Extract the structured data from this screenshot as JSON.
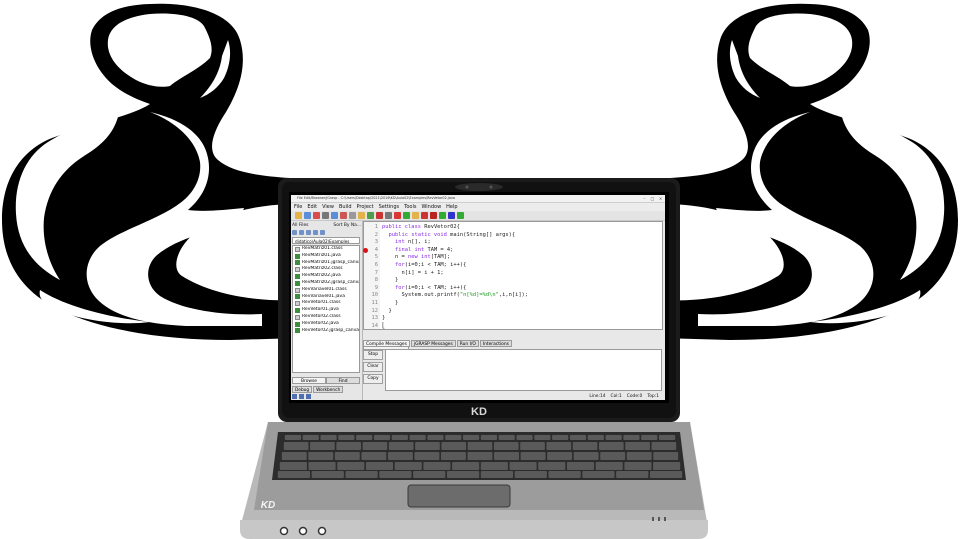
{
  "window": {
    "title": "File Edit/Browser/jGrasp - C:\\Users\\Desktop\\2021\\2016\\KD\\Aula02\\Examples\\RevVetor02.java",
    "min_glyph": "–",
    "max_glyph": "□",
    "close_glyph": "×"
  },
  "menu": [
    "File",
    "Edit",
    "View",
    "Build",
    "Project",
    "Settings",
    "Tools",
    "Window",
    "Help"
  ],
  "left_pane": {
    "filter_label": "All Files",
    "sort_label": "Sort By Na...",
    "path": "didatico\\Aula02\\Examples",
    "files": [
      {
        "name": "RevMatriz01.class",
        "kind": "class"
      },
      {
        "name": "RevMatriz01.java",
        "kind": "java"
      },
      {
        "name": "RevMatriz01.jgrasp_canvas",
        "kind": "java"
      },
      {
        "name": "RevMatriz02.class",
        "kind": "class"
      },
      {
        "name": "RevMatriz02.java",
        "kind": "java"
      },
      {
        "name": "RevMatriz02.jgrasp_canvas",
        "kind": "java"
      },
      {
        "name": "RevVariavel01.class",
        "kind": "class"
      },
      {
        "name": "RevVariavel01.java",
        "kind": "java"
      },
      {
        "name": "RevVetor01.class",
        "kind": "class"
      },
      {
        "name": "RevVetor01.java",
        "kind": "java"
      },
      {
        "name": "RevVetor02.class",
        "kind": "class"
      },
      {
        "name": "RevVetor02.java",
        "kind": "java"
      },
      {
        "name": "RevVetor02.jgrasp_canvas",
        "kind": "java"
      }
    ],
    "tabs": [
      "Browse",
      "Find"
    ],
    "tabs2": [
      "Debug",
      "Workbench"
    ]
  },
  "editor": {
    "file_tab": "RevVetor02.java",
    "breakpoint_line": 4,
    "lines": [
      {
        "n": "1",
        "parts": [
          [
            "kw",
            "public class "
          ],
          [
            "pl",
            "RevVetor02{"
          ]
        ]
      },
      {
        "n": "2",
        "parts": [
          [
            "pl",
            "  "
          ],
          [
            "kw",
            "public static void "
          ],
          [
            "pl",
            "main(String[] args){"
          ]
        ]
      },
      {
        "n": "3",
        "parts": [
          [
            "pl",
            "    "
          ],
          [
            "kw",
            "int "
          ],
          [
            "pl",
            "n[], i;"
          ]
        ]
      },
      {
        "n": "4",
        "parts": [
          [
            "pl",
            "    "
          ],
          [
            "kw",
            "final int "
          ],
          [
            "pl",
            "TAM = 4;"
          ]
        ]
      },
      {
        "n": "5",
        "parts": [
          [
            "pl",
            "    n = "
          ],
          [
            "kw",
            "new int"
          ],
          [
            "pl",
            "[TAM];"
          ]
        ]
      },
      {
        "n": "6",
        "parts": [
          [
            "pl",
            "    "
          ],
          [
            "kw",
            "for"
          ],
          [
            "pl",
            "(i=0;i < TAM; i++){"
          ]
        ]
      },
      {
        "n": "7",
        "parts": [
          [
            "pl",
            "      n[i] = i + 1;"
          ]
        ]
      },
      {
        "n": "8",
        "parts": [
          [
            "pl",
            "    }"
          ]
        ]
      },
      {
        "n": "9",
        "parts": [
          [
            "pl",
            "    "
          ],
          [
            "kw",
            "for"
          ],
          [
            "pl",
            "(i=0;i < TAM; i++){"
          ]
        ]
      },
      {
        "n": "10",
        "parts": [
          [
            "pl",
            "      System.out.printf("
          ],
          [
            "st",
            "\"n[%d]=%d\\n\""
          ],
          [
            "pl",
            ",i,n[i]);"
          ]
        ]
      },
      {
        "n": "11",
        "parts": [
          [
            "pl",
            "    }"
          ]
        ]
      },
      {
        "n": "12",
        "parts": [
          [
            "pl",
            "  }"
          ]
        ]
      },
      {
        "n": "13",
        "parts": [
          [
            "pl",
            "}"
          ]
        ]
      },
      {
        "n": "14",
        "parts": [
          [
            "pl",
            "⎣"
          ]
        ]
      }
    ]
  },
  "messages": {
    "tabs": [
      "Compile Messages",
      "jGRASP Messages",
      "Run I/O",
      "Interactions"
    ],
    "buttons": [
      "Stop",
      "Clear",
      "Copy"
    ]
  },
  "status": {
    "line": "Line:14",
    "col": "Col:1",
    "code": "Code:0",
    "top": "Top:1"
  },
  "laptop": {
    "lid_logo": "KD",
    "base_logo": "KD"
  },
  "colors": {
    "arms": "#000000",
    "lid": "#1a1a1a",
    "keyword": "#8a2be2",
    "string": "#1a9a1a",
    "breakpoint": "#dd1111"
  }
}
